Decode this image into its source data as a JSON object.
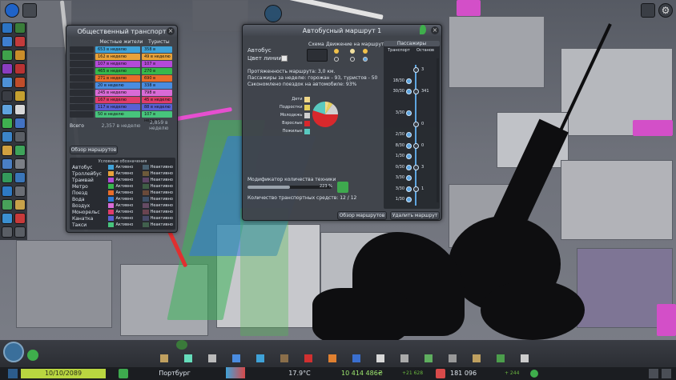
{
  "transport_panel": {
    "title": "Общественный транспорт",
    "col_local": "Местные жители",
    "col_tourists": "Туристы",
    "rows": [
      {
        "local": "653 в неделю",
        "tourist": "358 в неделю",
        "color": "#3fa2d8"
      },
      {
        "local": "162 в неделю",
        "tourist": "49 в неделю",
        "color": "#e8a23a"
      },
      {
        "local": "107 в неделю",
        "tourist": "107 в неделю",
        "color": "#b44ad8"
      },
      {
        "local": "465 в неделю",
        "tourist": "270 в неделю",
        "color": "#36b84c"
      },
      {
        "local": "271 в неделю",
        "tourist": "690 в неделю",
        "color": "#e86d2a"
      },
      {
        "local": "20 в неделю",
        "tourist": "338 в неделю",
        "color": "#4a8ce0"
      },
      {
        "local": "245 в неделю",
        "tourist": "798 в неделю",
        "color": "#d96bd6"
      },
      {
        "local": "167 в неделю",
        "tourist": "45 в неделю",
        "color": "#e03c6a"
      },
      {
        "local": "117 в неделю",
        "tourist": "88 в неделю",
        "color": "#5961d4"
      },
      {
        "local": "50 в неделю",
        "tourist": "107 в неделю",
        "color": "#47c47c"
      }
    ],
    "total_label": "Всего",
    "total_local": "2,357 в неделю",
    "total_tourist": "2,859 в неделю",
    "overview_button": "Обзор маршрутов",
    "legend_title": "Условные обозначения",
    "legend": [
      {
        "name": "Автобус",
        "active_color": "#3fa2d8",
        "inactive_color": "#496070"
      },
      {
        "name": "Троллейбус",
        "active_color": "#e8a23a",
        "inactive_color": "#6d5a3a"
      },
      {
        "name": "Трамвай",
        "active_color": "#b44ad8",
        "inactive_color": "#5e4467"
      },
      {
        "name": "Метро",
        "active_color": "#36b84c",
        "inactive_color": "#3f5e45"
      },
      {
        "name": "Поезд",
        "active_color": "#e86d2a",
        "inactive_color": "#6a4a3a"
      },
      {
        "name": "Вода",
        "active_color": "#2f7ad8",
        "inactive_color": "#3e5068"
      },
      {
        "name": "Воздух",
        "active_color": "#d96bd6",
        "inactive_color": "#654b64"
      },
      {
        "name": "Монорельс",
        "active_color": "#e03c6a",
        "inactive_color": "#6a4450"
      },
      {
        "name": "Канатка",
        "active_color": "#5961d4",
        "inactive_color": "#474a69"
      },
      {
        "name": "Такси",
        "active_color": "#47c47c",
        "inactive_color": "#41604d"
      }
    ],
    "active_label": "Активно",
    "inactive_label": "Неактивно"
  },
  "route_panel": {
    "title": "Автобусный маршрут 1",
    "type_label": "Автобус",
    "colors_label": "Цвет линии",
    "scheme_label": "Схема",
    "direction_label": "Движение на маршруте",
    "length": "Протяженность маршрута: 3,0 км.",
    "passengers": "Пассажиры за неделю: горожан - 93, туристов - 50",
    "saved_cars": "Сэкономлено поездок на автомобиле: 93%",
    "age_groups": [
      {
        "label": "Дети",
        "color": "#f1d88a"
      },
      {
        "label": "Подростки",
        "color": "#e7d05a"
      },
      {
        "label": "Молодежь",
        "color": "#d0d0d0"
      },
      {
        "label": "Взрослые",
        "color": "#d8282c"
      },
      {
        "label": "Пожилые",
        "color": "#59c9c0"
      }
    ],
    "age_shares": [
      0.05,
      0.05,
      0.15,
      0.55,
      0.2
    ],
    "vehicle_modifier_label": "Модификатор количества техники",
    "vehicle_modifier_value": "223 %",
    "vehicle_modifier_fraction": 0.5,
    "vehicle_count": "Количество транспортных средств: 12 / 12",
    "overview_button": "Обзор маршрутов",
    "delete_button": "Удалить маршрут",
    "pax_header": "Пассажиры",
    "col_transport": "Транспорт",
    "col_stop": "Останов",
    "stops": [
      {
        "vehicle": "",
        "stop": "3"
      },
      {
        "vehicle": "18/30",
        "stop": ""
      },
      {
        "vehicle": "30/30",
        "stop": "341"
      },
      {
        "vehicle": "",
        "stop": ""
      },
      {
        "vehicle": "3/30",
        "stop": ""
      },
      {
        "vehicle": "",
        "stop": "0"
      },
      {
        "vehicle": "2/30",
        "stop": ""
      },
      {
        "vehicle": "8/30",
        "stop": "0"
      },
      {
        "vehicle": "1/30",
        "stop": ""
      },
      {
        "vehicle": "0/30",
        "stop": "3"
      },
      {
        "vehicle": "3/30",
        "stop": ""
      },
      {
        "vehicle": "3/30",
        "stop": "1"
      },
      {
        "vehicle": "1/30",
        "stop": ""
      }
    ]
  },
  "bottom_bar": {
    "date": "10/10/2089",
    "city_name": "Портбург",
    "temperature": "17.9°C",
    "money": "10 414 486₴",
    "income": "+21 628",
    "population": "181 096",
    "pop_change": "+ 244"
  }
}
